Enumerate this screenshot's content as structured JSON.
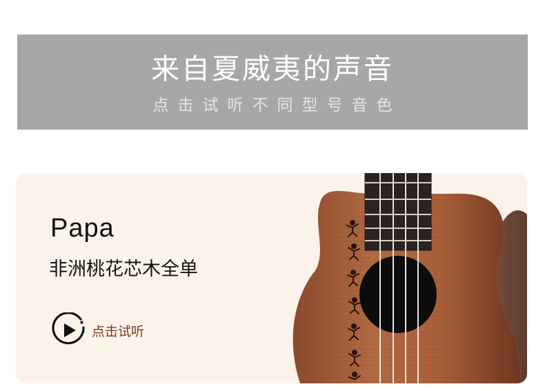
{
  "banner": {
    "title": "来自夏威夷的声音",
    "subtitle": "点击试听不同型号音色",
    "background_color": "#a7a7a7"
  },
  "product": {
    "name": "Papa",
    "description": "非洲桃花芯木全单",
    "listen_label": "点击试听",
    "card_color": "#fbf3ea",
    "accent_color": "#7a3a1f",
    "icons": [
      "play-circle-icon",
      "ukulele-image"
    ]
  }
}
